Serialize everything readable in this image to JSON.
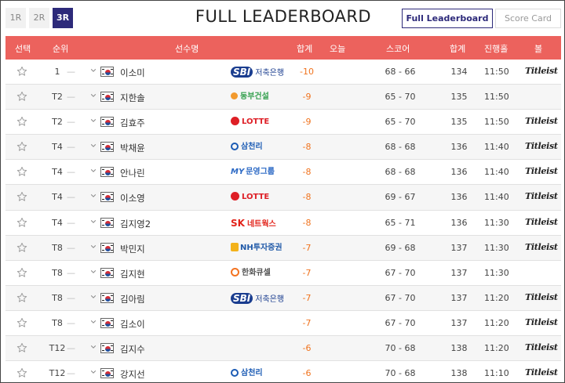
{
  "rounds": [
    {
      "label": "1R",
      "active": false
    },
    {
      "label": "2R",
      "active": false
    },
    {
      "label": "3R",
      "active": true
    }
  ],
  "title": "FULL LEADERBOARD",
  "views": {
    "leaderboard": "Full Leaderboard",
    "scorecard": "Score Card"
  },
  "columns": {
    "select": "선택",
    "rank": "순위",
    "player": "선수명",
    "total": "합계",
    "today": "오늘",
    "score": "스코어",
    "sum": "합계",
    "progress": "진행홀",
    "ball": "볼"
  },
  "colors": {
    "header": "#ec625d",
    "accent": "#2d2a7a",
    "total": "#f0731e"
  },
  "rows": [
    {
      "rank": "1",
      "name": "이소미",
      "sponsor": "sbi",
      "sponsor_text": "SBI",
      "sponsor_sub": "저축은행",
      "total": "-10",
      "score": "68 - 66",
      "sum": "134",
      "progress": "11:50",
      "ball": "Titleist"
    },
    {
      "rank": "T2",
      "name": "지한솔",
      "sponsor": "dongbu",
      "sponsor_text": "",
      "sponsor_sub": "동부건설",
      "total": "-9",
      "score": "65 - 70",
      "sum": "135",
      "progress": "11:50",
      "ball": ""
    },
    {
      "rank": "T2",
      "name": "김효주",
      "sponsor": "lotte",
      "sponsor_text": "",
      "sponsor_sub": "LOTTE",
      "total": "-9",
      "score": "65 - 70",
      "sum": "135",
      "progress": "11:50",
      "ball": "Titleist"
    },
    {
      "rank": "T4",
      "name": "박채윤",
      "sponsor": "samchully",
      "sponsor_text": "",
      "sponsor_sub": "삼천리",
      "total": "-8",
      "score": "68 - 68",
      "sum": "136",
      "progress": "11:40",
      "ball": "Titleist"
    },
    {
      "rank": "T4",
      "name": "안나린",
      "sponsor": "woonyoung",
      "sponsor_text": "MY",
      "sponsor_sub": "문영그룹",
      "total": "-8",
      "score": "68 - 68",
      "sum": "136",
      "progress": "11:40",
      "ball": "Titleist"
    },
    {
      "rank": "T4",
      "name": "이소영",
      "sponsor": "lotte",
      "sponsor_text": "",
      "sponsor_sub": "LOTTE",
      "total": "-8",
      "score": "69 - 67",
      "sum": "136",
      "progress": "11:40",
      "ball": "Titleist"
    },
    {
      "rank": "T4",
      "name": "김지영2",
      "sponsor": "sk",
      "sponsor_text": "SK",
      "sponsor_sub": "네트웍스",
      "total": "-8",
      "score": "65 - 71",
      "sum": "136",
      "progress": "11:30",
      "ball": "Titleist"
    },
    {
      "rank": "T8",
      "name": "박민지",
      "sponsor": "nh",
      "sponsor_text": "",
      "sponsor_sub": "NH투자증권",
      "total": "-7",
      "score": "69 - 68",
      "sum": "137",
      "progress": "11:30",
      "ball": "Titleist"
    },
    {
      "rank": "T8",
      "name": "김지현",
      "sponsor": "hanwha",
      "sponsor_text": "",
      "sponsor_sub": "한화큐셀",
      "total": "-7",
      "score": "67 - 70",
      "sum": "137",
      "progress": "11:30",
      "ball": ""
    },
    {
      "rank": "T8",
      "name": "김아림",
      "sponsor": "sbi",
      "sponsor_text": "SBI",
      "sponsor_sub": "저축은행",
      "total": "-7",
      "score": "67 - 70",
      "sum": "137",
      "progress": "11:20",
      "ball": "Titleist"
    },
    {
      "rank": "T8",
      "name": "김소이",
      "sponsor": "",
      "sponsor_text": "",
      "sponsor_sub": "",
      "total": "-7",
      "score": "67 - 70",
      "sum": "137",
      "progress": "11:20",
      "ball": "Titleist"
    },
    {
      "rank": "T12",
      "name": "김지수",
      "sponsor": "",
      "sponsor_text": "",
      "sponsor_sub": "",
      "total": "-6",
      "score": "70 - 68",
      "sum": "138",
      "progress": "11:20",
      "ball": "Titleist"
    },
    {
      "rank": "T12",
      "name": "강지선",
      "sponsor": "samchully",
      "sponsor_text": "",
      "sponsor_sub": "삼천리",
      "total": "-6",
      "score": "70 - 68",
      "sum": "138",
      "progress": "11:10",
      "ball": "Titleist"
    }
  ]
}
